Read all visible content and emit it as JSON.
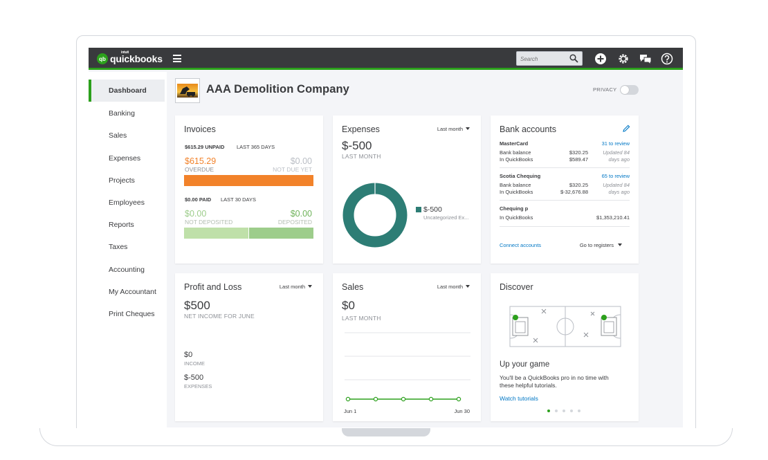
{
  "topbar": {
    "brand_badge": "qb",
    "brand_intuit": "intuit",
    "brand_name": "quickbooks",
    "search_placeholder": "Search",
    "icons": [
      "plus-icon",
      "gear-icon",
      "chat-icon",
      "help-icon"
    ]
  },
  "sidebar": {
    "items": [
      {
        "label": "Dashboard",
        "active": true
      },
      {
        "label": "Banking"
      },
      {
        "label": "Sales"
      },
      {
        "label": "Expenses"
      },
      {
        "label": "Projects"
      },
      {
        "label": "Employees"
      },
      {
        "label": "Reports"
      },
      {
        "label": "Taxes"
      },
      {
        "label": "Accounting"
      },
      {
        "label": "My Accountant"
      },
      {
        "label": "Print Cheques"
      }
    ]
  },
  "header": {
    "company_name": "AAA Demolition Company",
    "privacy_label": "PRIVACY"
  },
  "invoices": {
    "title": "Invoices",
    "unpaid_amount": "$615.29 UNPAID",
    "unpaid_period": "LAST 365 DAYS",
    "overdue_amount": "$615.29",
    "overdue_label": "OVERDUE",
    "not_due_amount": "$0.00",
    "not_due_label": "NOT DUE YET",
    "paid_amount": "$0.00 PAID",
    "paid_period": "LAST 30 DAYS",
    "not_deposited_amount": "$0.00",
    "not_deposited_label": "NOT DEPOSITED",
    "deposited_amount": "$0.00",
    "deposited_label": "DEPOSITED",
    "colors": {
      "overdue": "#f2822a",
      "not_deposited": "#bfe0a9",
      "deposited": "#9dcd8b"
    }
  },
  "expenses": {
    "title": "Expenses",
    "period": "Last month",
    "amount": "$-500",
    "amount_label": "LAST MONTH",
    "legend_amount": "$-500",
    "legend_category": "Uncategorized Ex...",
    "color": "#2d7d75"
  },
  "bank_accounts": {
    "title": "Bank accounts",
    "accounts": [
      {
        "name": "MasterCard",
        "review": "31 to review",
        "bank_label": "Bank balance",
        "bank_value": "$320.25",
        "updated": "Updated 84",
        "updated2": "days ago",
        "qb_label": "In QuickBooks",
        "qb_value": "$589.47"
      },
      {
        "name": "Scotia Chequing",
        "review": "65 to review",
        "bank_label": "Bank balance",
        "bank_value": "$320.25",
        "updated": "Updated 84",
        "updated2": "days ago",
        "qb_label": "In QuickBooks",
        "qb_value": "$-32,676.88"
      },
      {
        "name": "Chequing p",
        "qb_label": "In QuickBooks",
        "qb_value": "$1,353,210.41"
      }
    ],
    "connect_label": "Connect accounts",
    "registers_label": "Go to registers"
  },
  "profit_loss": {
    "title": "Profit and Loss",
    "period": "Last month",
    "amount": "$500",
    "amount_label": "NET INCOME FOR JUNE",
    "income_amount": "$0",
    "income_label": "INCOME",
    "expenses_amount": "$-500",
    "expenses_label": "EXPENSES"
  },
  "sales": {
    "title": "Sales",
    "period": "Last month",
    "amount": "$0",
    "amount_label": "LAST MONTH",
    "x_start": "Jun 1",
    "x_end": "Jun 30"
  },
  "discover": {
    "title": "Discover",
    "heading": "Up your game",
    "body_line1": "You'll be a QuickBooks pro in no time with",
    "body_line2": "these helpful tutorials.",
    "link": "Watch tutorials",
    "page_count": 5,
    "current_page": 1
  },
  "chart_data": [
    {
      "type": "pie",
      "title": "Expenses",
      "categories": [
        "Uncategorized Ex..."
      ],
      "values": [
        -500
      ],
      "colors": [
        "#2d7d75"
      ]
    },
    {
      "type": "line",
      "title": "Sales",
      "x": [
        "Jun 1",
        "",
        "",
        "",
        "Jun 30"
      ],
      "series": [
        {
          "values": [
            0,
            0,
            0,
            0,
            0
          ]
        }
      ],
      "color": "#2ca01c"
    }
  ]
}
